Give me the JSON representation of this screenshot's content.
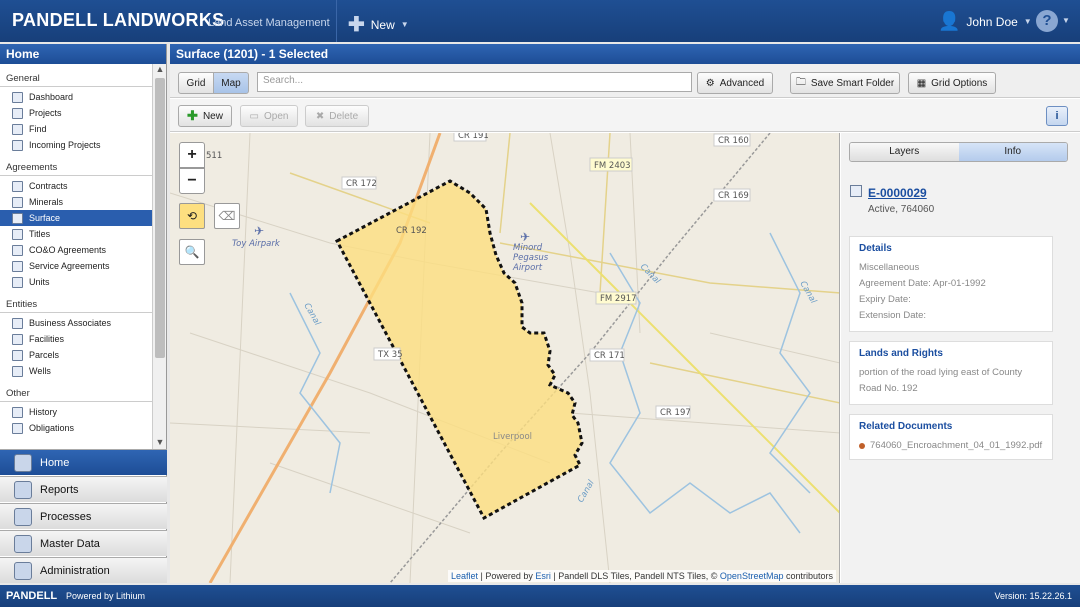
{
  "app": {
    "brand": "PANDELL LANDWORKS",
    "subtitle": "Land Asset Management",
    "new_label": "New",
    "user_name": "John Doe",
    "help_label": "?"
  },
  "sidebar": {
    "title": "Home",
    "sections": [
      {
        "name": "General",
        "items": [
          "Dashboard",
          "Projects",
          "Find",
          "Incoming Projects"
        ]
      },
      {
        "name": "Agreements",
        "items": [
          "Contracts",
          "Minerals",
          "Surface",
          "Titles",
          "CO&O Agreements",
          "Service Agreements",
          "Units"
        ]
      },
      {
        "name": "Entities",
        "items": [
          "Business Associates",
          "Facilities",
          "Parcels",
          "Wells"
        ]
      },
      {
        "name": "Other",
        "items": [
          "History",
          "Obligations"
        ]
      }
    ],
    "active_item": "Surface",
    "bottom_nav": [
      "Home",
      "Reports",
      "Processes",
      "Master Data",
      "Administration"
    ]
  },
  "main": {
    "title": "Surface (1201) - 1 Selected",
    "view_grid": "Grid",
    "view_map": "Map",
    "search_placeholder": "Search...",
    "advanced": "Advanced",
    "save_smart_folder": "Save Smart Folder",
    "grid_options": "Grid Options",
    "new": "New",
    "open": "Open",
    "delete": "Delete",
    "info_icon": "i"
  },
  "map": {
    "zoom_in": "+",
    "zoom_out": "−",
    "labels": [
      {
        "text": "CR 191"
      },
      {
        "text": "CR 160"
      },
      {
        "text": "FM 2403"
      },
      {
        "text": "CR 172"
      },
      {
        "text": "CR 169"
      },
      {
        "text": "CR 192"
      },
      {
        "text": "Toy Airpark"
      },
      {
        "text": "Minord"
      },
      {
        "text": "Pegasus"
      },
      {
        "text": "Airport"
      },
      {
        "text": "FM 2917"
      },
      {
        "text": "CR 171"
      },
      {
        "text": "CR 197"
      },
      {
        "text": "TX 35"
      },
      {
        "text": "Liverpool"
      },
      {
        "text": "Canal"
      },
      {
        "text": "Canal"
      },
      {
        "text": "Canal"
      },
      {
        "text": "Canal"
      },
      {
        "text": "511"
      }
    ],
    "attribution": {
      "leaflet": "Leaflet",
      "sep1": " | Powered by ",
      "esri": "Esri",
      "rest": " | Pandell DLS Tiles, Pandell NTS Tiles, © ",
      "osm": "OpenStreetMap",
      "end": " contributors"
    }
  },
  "info": {
    "tab_layers": "Layers",
    "tab_info": "Info",
    "record_id": "E-0000029",
    "record_status": "Active, 764060",
    "details": {
      "title": "Details",
      "lines": [
        "Miscellaneous",
        "Agreement Date: Apr-01-1992",
        "Expiry Date:",
        "Extension Date:"
      ]
    },
    "lands": {
      "title": "Lands and Rights",
      "lines": [
        "portion of the road lying east of County",
        "Road No. 192"
      ]
    },
    "docs": {
      "title": "Related Documents",
      "file": "764060_Encroachment_04_01_1992.pdf"
    }
  },
  "footer": {
    "logo": "PANDELL",
    "powered": "Powered by Lithium",
    "version": "Version:  15.22.26.1"
  },
  "colors": {
    "header": "#1f4f93",
    "accent": "#2a5eae",
    "parcel_fill": "#fddf80"
  }
}
